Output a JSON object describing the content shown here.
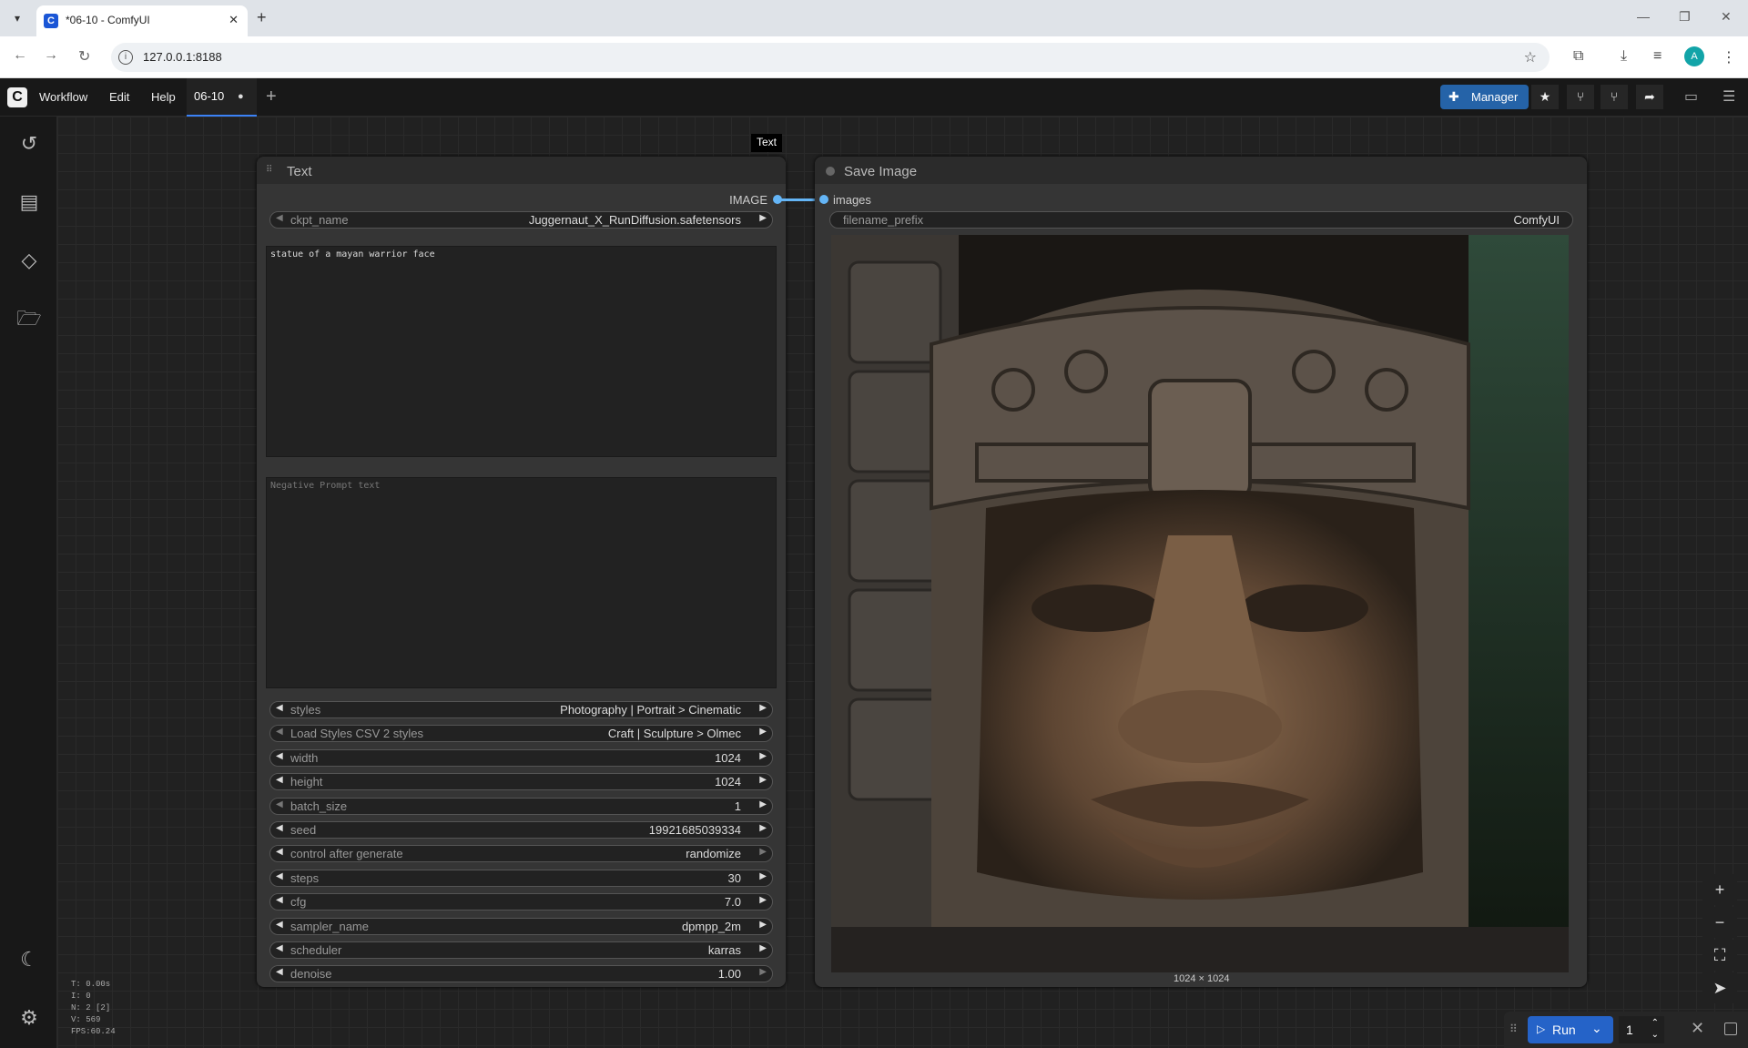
{
  "browser": {
    "tab_title": "*06-10 - ComfyUI",
    "url": "127.0.0.1:8188",
    "profile_initial": "A"
  },
  "app": {
    "menu": [
      "Workflow",
      "Edit",
      "Help"
    ],
    "workflow_tab": "06-10",
    "manager_label": "Manager"
  },
  "text_node": {
    "title": "Text",
    "output_label": "IMAGE",
    "ckpt": {
      "name": "ckpt_name",
      "value": "Juggernaut_X_RunDiffusion.safetensors"
    },
    "positive_prompt": "statue of a mayan warrior face",
    "negative_placeholder": "Negative Prompt text",
    "widgets": [
      {
        "name": "styles",
        "value": "Photography | Portrait > Cinematic"
      },
      {
        "name": "Load Styles CSV 2 styles",
        "value": "Craft | Sculpture > Olmec"
      },
      {
        "name": "width",
        "value": "1024"
      },
      {
        "name": "height",
        "value": "1024"
      },
      {
        "name": "batch_size",
        "value": "1"
      },
      {
        "name": "seed",
        "value": "19921685039334"
      },
      {
        "name": "control after generate",
        "value": "randomize"
      },
      {
        "name": "steps",
        "value": "30"
      },
      {
        "name": "cfg",
        "value": "7.0"
      },
      {
        "name": "sampler_name",
        "value": "dpmpp_2m"
      },
      {
        "name": "scheduler",
        "value": "karras"
      },
      {
        "name": "denoise",
        "value": "1.00"
      }
    ]
  },
  "save_node": {
    "title": "Save Image",
    "input_label": "images",
    "prefix": {
      "name": "filename_prefix",
      "value": "ComfyUI"
    },
    "image_size": "1024 × 1024"
  },
  "link_tooltip": "Text",
  "stats": [
    "T: 0.00s",
    "I: 0",
    "N: 2 [2]",
    "V: 569",
    "FPS:60.24"
  ],
  "run": {
    "label": "Run",
    "count": "1"
  },
  "icons": {
    "sidebar": [
      "history-icon",
      "node-library-icon",
      "model-library-icon",
      "workflows-icon",
      "theme-toggle-icon",
      "settings-icon"
    ]
  }
}
